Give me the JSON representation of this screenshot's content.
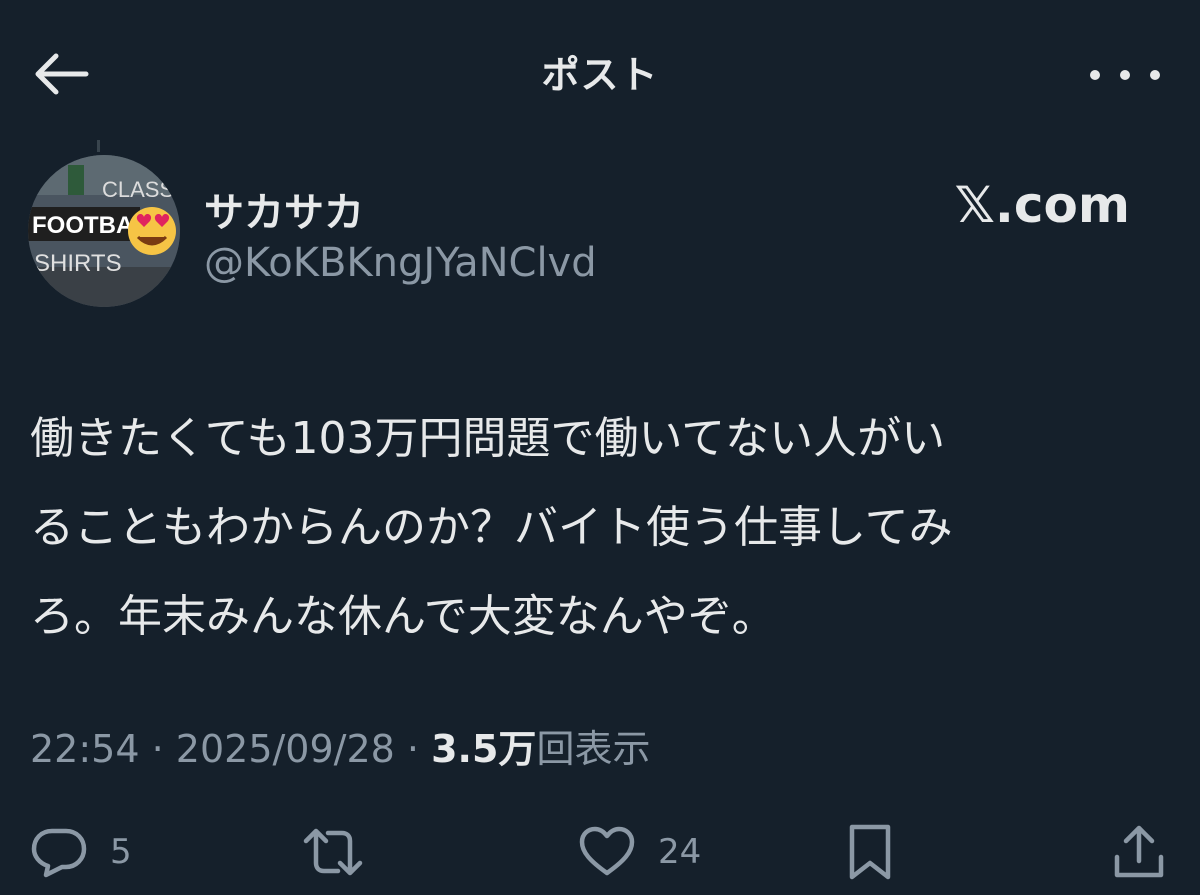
{
  "header": {
    "title": "ポスト",
    "back_icon": "arrow-left-icon",
    "more_icon": "more-horizontal-icon"
  },
  "author": {
    "display_name": "サカサカ",
    "handle": "@KoKBKngJYaNClvd",
    "avatar_text": [
      "CLASSIC",
      "FOOTBA",
      "SHIRTS"
    ]
  },
  "source_label": "𝕏.com",
  "post": {
    "lines": [
      "働きたくても103万円問題で働いてない人がい",
      "ることもわからんのか？バイト使う仕事してみ",
      "ろ。年末みんな休んで大変なんやぞ。"
    ]
  },
  "meta": {
    "time": "22:54",
    "separator": "·",
    "date": "2025/09/28",
    "views_count": "3.5万",
    "views_label": "回表示"
  },
  "actions": {
    "reply_count": "5",
    "repost_count": "",
    "like_count": "24"
  },
  "colors": {
    "background": "#15202b",
    "text": "#e7e9ea",
    "secondary_text": "#8b98a5"
  }
}
